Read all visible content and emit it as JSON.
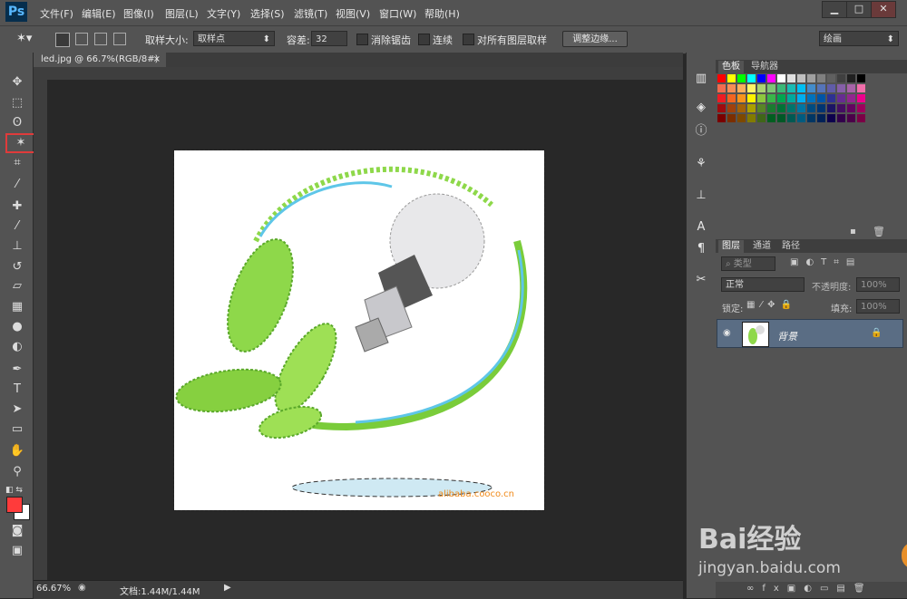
{
  "app": {
    "logo": "Ps"
  },
  "menus": [
    "文件(F)",
    "编辑(E)",
    "图像(I)",
    "图层(L)",
    "文字(Y)",
    "选择(S)",
    "滤镜(T)",
    "视图(V)",
    "窗口(W)",
    "帮助(H)"
  ],
  "window_controls": {
    "minimize": "▁",
    "maximize": "□",
    "close": "✕"
  },
  "options": {
    "sample_size_label": "取样大小:",
    "sample_size_value": "取样点",
    "tolerance_label": "容差:",
    "tolerance_value": "32",
    "antialias_label": "消除锯齿",
    "contiguous_label": "连续",
    "sample_all_label": "对所有图层取样",
    "refine_edge_button": "调整边缘...",
    "workspace_value": "绘画"
  },
  "document": {
    "tab_label": "led.jpg @ 66.7%(RGB/8#)",
    "tab_close": "×",
    "canvas_caption": "alibaba.cooco.cn",
    "zoom": "66.67%",
    "doc_size": "文档:1.44M/1.44M"
  },
  "toolbar": {
    "active_tool": "magic-wand",
    "active_color": "#ff3b3b"
  },
  "panels": {
    "color_tabs": [
      "色板",
      "导航器"
    ],
    "layer_tabs": [
      "图层",
      "通道",
      "路径"
    ],
    "filter_kind": "类型",
    "blend_mode": "正常",
    "opacity_label": "不透明度:",
    "opacity_value": "100%",
    "lock_label": "锁定:",
    "fill_label": "填充:",
    "fill_value": "100%",
    "layers": [
      {
        "name": "背景",
        "locked": true,
        "visible": true
      }
    ]
  },
  "watermark": {
    "brand": "Bai经验",
    "url": "jingyan.baidu.com"
  }
}
